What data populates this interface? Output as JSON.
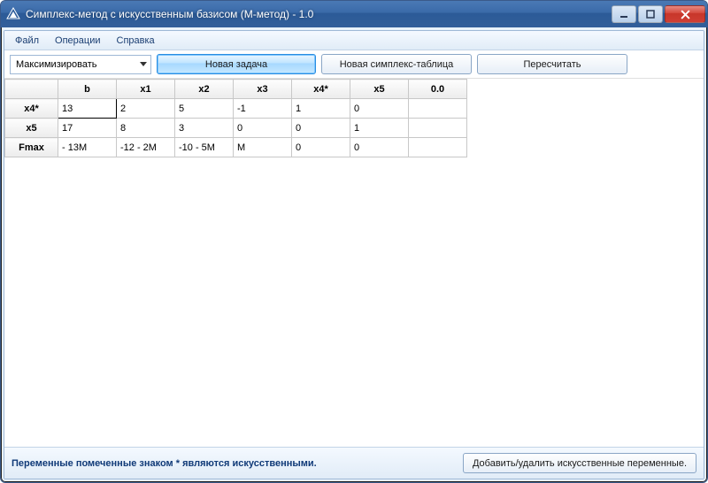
{
  "window": {
    "title": "Симплекс-метод с искусственным базисом (М-метод) - 1.0"
  },
  "menu": {
    "file": "Файл",
    "operations": "Операции",
    "help": "Справка"
  },
  "toolbar": {
    "mode_selected": "Максимизировать",
    "new_task": "Новая задача",
    "new_table": "Новая симплекс-таблица",
    "recalc": "Пересчитать"
  },
  "grid": {
    "headers": [
      "b",
      "x1",
      "x2",
      "x3",
      "x4*",
      "x5",
      "0.0"
    ],
    "rows": [
      {
        "label": "x4*",
        "cells": [
          "13",
          "2",
          "5",
          "-1",
          "1",
          "0",
          ""
        ]
      },
      {
        "label": "x5",
        "cells": [
          "17",
          "8",
          "3",
          "0",
          "0",
          "1",
          ""
        ]
      },
      {
        "label": "Fmax",
        "cells": [
          "- 13M",
          "-12 - 2M",
          "-10 - 5M",
          "M",
          "0",
          "0",
          ""
        ]
      }
    ]
  },
  "status": {
    "note": "Переменные помеченные знаком * являются искусственными.",
    "button": "Добавить/удалить искусственные переменные."
  }
}
